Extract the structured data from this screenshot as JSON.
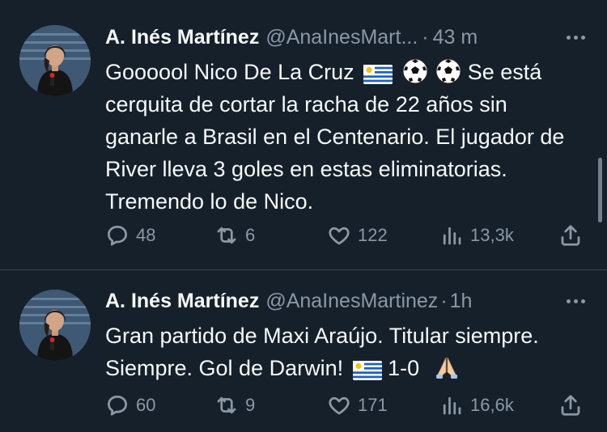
{
  "tweets": [
    {
      "author_name": "A. Inés Martínez",
      "handle": "@AnaInesMart...",
      "separator": "·",
      "time": "43 m",
      "text_parts": [
        "Goooool Nico De La Cruz",
        "Se está cerquita de cortar la racha de 22 años sin ganarle a Brasil en el Centenario. El jugador de River lleva 3 goles en estas eliminatorias. Tremendo lo de Nico."
      ],
      "emojis": [
        "uruguay-flag",
        "soccer-ball",
        "soccer-ball"
      ],
      "replies": "48",
      "retweets": "6",
      "likes": "122",
      "views": "13,3k"
    },
    {
      "author_name": "A. Inés Martínez",
      "handle": "@AnaInesMartinez",
      "separator": "·",
      "time": "1h",
      "text_parts": [
        "Gran partido de Maxi Araújo. Titular siempre. Siempre. Gol de Darwin!",
        "1-0"
      ],
      "emojis": [
        "uruguay-flag",
        "folded-hands"
      ],
      "replies": "60",
      "retweets": "9",
      "likes": "171",
      "views": "16,6k"
    }
  ],
  "colors": {
    "background": "#15202b",
    "text_primary": "#f7f9f9",
    "text_secondary": "#8b98a5",
    "divider": "#38444d"
  },
  "icons": [
    "reply-icon",
    "retweet-icon",
    "like-icon",
    "views-icon",
    "share-icon",
    "more-icon"
  ]
}
